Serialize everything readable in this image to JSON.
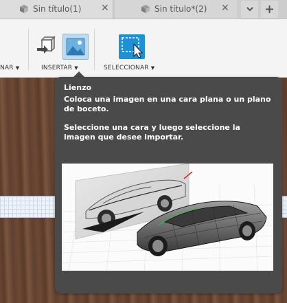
{
  "tabs": [
    {
      "label": "Sin título(1)",
      "close": "✕",
      "icon": "cube-icon"
    },
    {
      "label": "Sin título*(2)",
      "close": "✕",
      "icon": "cube-icon"
    }
  ],
  "tab_actions": {
    "overflow": "chevron-down-icon",
    "add": "plus-icon"
  },
  "toolbar": {
    "groups": [
      {
        "label": "NAR"
      },
      {
        "label": "INSERTAR"
      },
      {
        "label": "SELECCIONAR"
      }
    ],
    "caret": "▼"
  },
  "tooltip": {
    "title": "Lienzo",
    "description": "Coloca una imagen en una cara plana o un plano de boceto.",
    "instruction": "Seleccione una cara y luego seleccione la imagen que desee importar."
  },
  "colors": {
    "tooltip_bg": "#4a4a4a",
    "select_accent": "#1e90d6",
    "toolbar_bg": "#f4f4f4"
  }
}
